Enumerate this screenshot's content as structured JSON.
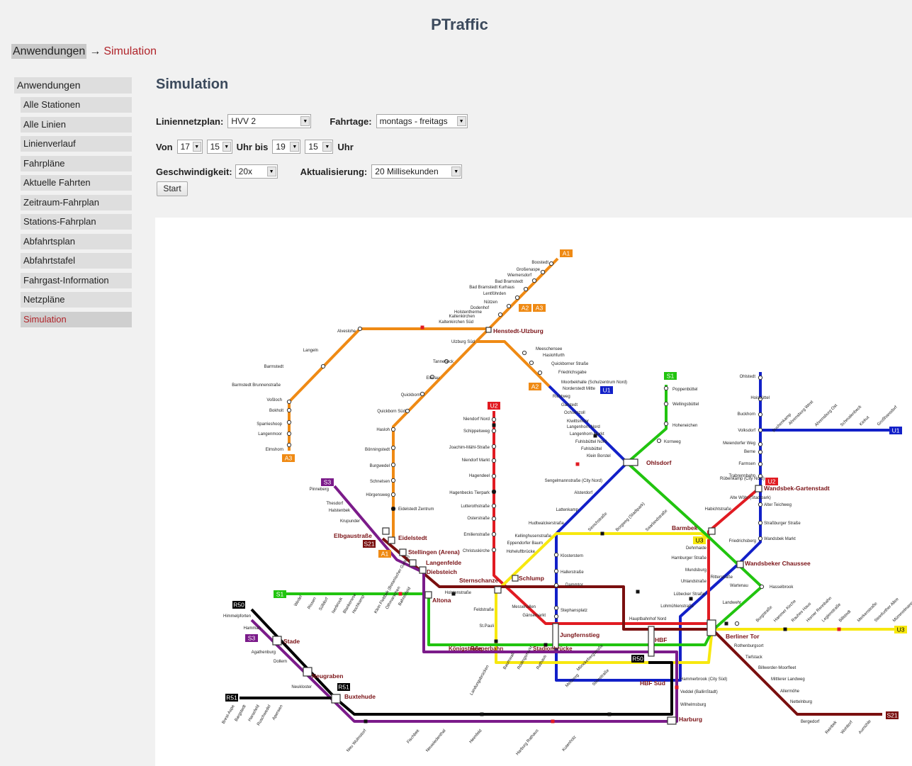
{
  "app": {
    "title": "PTraffic"
  },
  "breadcrumb": {
    "root": "Anwendungen",
    "separator": "→",
    "current": "Simulation"
  },
  "sidebar": {
    "heading": "Anwendungen",
    "items": [
      "Alle Stationen",
      "Alle Linien",
      "Linienverlauf",
      "Fahrpläne",
      "Aktuelle Fahrten",
      "Zeitraum-Fahrplan",
      "Stations-Fahrplan",
      "Abfahrtsplan",
      "Abfahrtstafel",
      "Fahrgast-Information",
      "Netzpläne",
      "Simulation"
    ],
    "active": "Simulation"
  },
  "content": {
    "title": "Simulation"
  },
  "form": {
    "liniennetzplan_label": "Liniennetzplan:",
    "liniennetzplan_value": "HVV 2",
    "fahrtage_label": "Fahrtage:",
    "fahrtage_value": "montags - freitags",
    "von_label": "Von",
    "von_hour": "17",
    "von_min": "15",
    "uhr_bis_label": "Uhr bis",
    "bis_hour": "19",
    "bis_min": "15",
    "uhr_label": "Uhr",
    "geschw_label": "Geschwindigkeit:",
    "geschw_value": "20x",
    "aktual_label": "Aktualisierung:",
    "aktual_value": "20 Millisekunden",
    "start_label": "Start"
  },
  "map": {
    "line_colors": {
      "A": "#ef8a14",
      "U1": "#1220c8",
      "U2": "#e11b22",
      "U3": "#f7e80f",
      "S1": "#21c40f",
      "S21": "#7a0f0f",
      "S3": "#7b1b8a",
      "R": "#000000"
    },
    "badges": [
      "A1",
      "A2",
      "A3",
      "A2",
      "A3",
      "U1",
      "U2",
      "S1",
      "S3",
      "S21",
      "A1",
      "U2",
      "U1",
      "U3",
      "U3",
      "S1",
      "R50",
      "S3",
      "R51",
      "R51",
      "R50",
      "S21"
    ],
    "major_stations": [
      "Henstedt-Ulzburg",
      "Ohlsdorf",
      "Wandsbek-Gartenstadt",
      "Eidelstedt",
      "Elbgaustraße",
      "Stellingen (Arena)",
      "Langenfelde",
      "Diebsteich",
      "Barmbek",
      "Wandsbeker Chaussee",
      "Sternschanze",
      "Schlump",
      "Altona",
      "Jungfernstieg",
      "HBF",
      "HBF Süd",
      "Berliner Tor",
      "Stade",
      "Neugraben",
      "Buxtehude",
      "Harburg"
    ],
    "stations_a": [
      "Boostedt",
      "Großenaspe",
      "Wiemersdorf",
      "Bad Bramstedt",
      "Bad Bramstedt Kurhaus",
      "Lentföhrden",
      "Nützen",
      "Dodenhof",
      "Holstentherme",
      "Kaltenkirchen",
      "Kaltenkirchen Süd",
      "Alveslohe",
      "Langeln",
      "Barmstedt",
      "Barmstedt Brunnenstraße",
      "Voßloch",
      "Bokholt",
      "Sparrieshoop",
      "Langenmoor",
      "Elmshorn",
      "Ulzburg Süd",
      "Tanneneck",
      "Ellerau",
      "Quickborn",
      "Quickborn Süd",
      "Hasloh",
      "Bönningstedt",
      "Burgwedel",
      "Schnelsen",
      "Hörgensweg",
      "Eidelstedt Zentrum",
      "Meeschensee",
      "Haslohfurth",
      "Quickborner Straße",
      "Friedrichsgabe",
      "Moorbekhalle (Schulzentrum Nord)",
      "Norderstedt Mitte",
      "Richtweg"
    ],
    "stations_u1": [
      "Garstedt",
      "Ochsenzoll",
      "Kiwittsmoor",
      "Langenhorn Nord",
      "Langenhorn Markt",
      "Fuhlsbüttel Nord",
      "Fuhlsbüttel",
      "Klein Borstel",
      "Sengelmannstraße (City Nord)",
      "Alsterdorf",
      "Lattenkamp",
      "Hudtwalckerstraße",
      "Kellinghusenstraße",
      "Eppendorfer Baum",
      "Hoheluftbrücke",
      "Klosterstern",
      "Hallerstraße",
      "Dammtor",
      "Stephansplatz",
      "Gänsemarkt",
      "Messehallen",
      "Mönckebergstraße",
      "Meßberg",
      "Steinstraße",
      "Ohlstedt",
      "Hoisbüttel",
      "Buckhorn",
      "Volksdorf",
      "Meiendorfer Weg",
      "Berne",
      "Farmsen",
      "Trabrennbahn",
      "Alter Teichweg",
      "Straßburger Straße",
      "Wandsbek Markt",
      "Ritterstraße",
      "Wartenau",
      "Hasselbrook",
      "Lohmühlenstraße",
      "Lübecker Straße",
      "Uhlandstraße",
      "Mundsburg",
      "Hamburger Straße",
      "Dehnhaide",
      "Buchenkamp",
      "Ahrensburg West",
      "Ahrensburg Ost",
      "Schmalenbeck",
      "Kiekut",
      "Großhansdorf"
    ],
    "stations_u2": [
      "Niendorf Nord",
      "Schippelsweg",
      "Joachim-Mähl-Straße",
      "Niendorf Markt",
      "Hagendeel",
      "Hagenbecks Tierpark",
      "Lutterothstraße",
      "Osterstraße",
      "Emilienstraße",
      "Christuskirche",
      "Habichtstraße",
      "Alte Wöhr (Stadtpark)",
      "Rübenkamp (City Nord)",
      "Friedrichsberg",
      "Landwehr"
    ],
    "stations_s": [
      "Poppenbüttel",
      "Wellingsbüttel",
      "Hoheneichen",
      "Kornweg",
      "Pinneberg",
      "Thesdorf",
      "Halstenbek",
      "Krupunder",
      "Wedel",
      "Rissen",
      "Sülldorf",
      "Iserbrook",
      "Blankenese",
      "Hochkamp",
      "Klein Flottbek (Botanischer Garten)",
      "Othmarschen",
      "Bahrenfeld",
      "Holstenstraße",
      "Feldstraße",
      "St.Pauli",
      "Landungsbrücken",
      "Baumwall",
      "Rödingsmarkt",
      "Rathaus",
      "Hauptbahnhof Nord",
      "Rothenburgsort",
      "Tiefstack",
      "Billwerder-Moorfleet",
      "Mittlerer Landweg",
      "Allermöhe",
      "Nettelnburg",
      "Bergedorf",
      "Reinbek",
      "Wohltorf",
      "Aumühle",
      "Hammerbrook (City Süd)",
      "Veddel (BallinStadt)",
      "Wilhelmsburg",
      "Himmelpforten",
      "Hammah",
      "Agathenburg",
      "Dollern",
      "Neukloster",
      "Neu Wulmstorf",
      "Fischbek",
      "Neuwiedenthal",
      "Heimfeld",
      "Harburg Rathaus",
      "Kutenholz",
      "Brest-Aspe",
      "Bargstedt",
      "Harsefeld",
      "Ruschwedel",
      "Apensen"
    ],
    "stations_u3": [
      "Saarlandstraße",
      "Borgweg (Stadtpark)",
      "Sierichstraße",
      "Burgstraße",
      "Hammer Kirche",
      "Rauhes Haus",
      "Horner Rennbahn",
      "Legienstraße",
      "Billstedt",
      "Merkenstraße",
      "Steinfurther Allee",
      "Mümmelmannsberg"
    ],
    "extra_labels": [
      "Reeperbahn",
      "Königstraße",
      "Stadionbrücke"
    ]
  }
}
